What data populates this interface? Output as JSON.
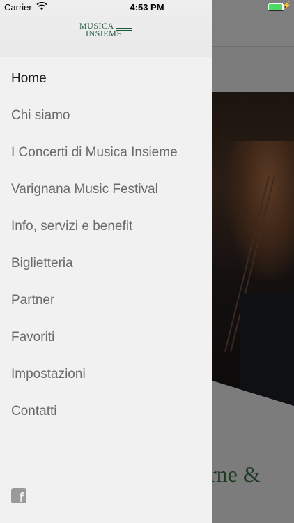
{
  "status_bar": {
    "carrier": "Carrier",
    "time": "4:53 PM"
  },
  "logo": {
    "line1": "MUSICA",
    "line2": "INSIEME"
  },
  "menu": {
    "items": [
      {
        "label": "Home"
      },
      {
        "label": "Chi siamo"
      },
      {
        "label": "I Concerti di Musica Insieme"
      },
      {
        "label": "Varignana Music Festival"
      },
      {
        "label": "Info, servizi e benefit"
      },
      {
        "label": "Biglietteria"
      },
      {
        "label": "Partner"
      },
      {
        "label": "Favoriti"
      },
      {
        "label": "Impostazioni"
      },
      {
        "label": "Contatti"
      }
    ],
    "active_index": 0
  },
  "background": {
    "title_fragment": "rne &"
  },
  "footer": {
    "social_icon": "facebook-icon"
  },
  "colors": {
    "brand_green": "#1e5a3a",
    "drawer_bg": "#f1f1f1",
    "overlay": "#7c7c7c",
    "battery": "#4cd964"
  }
}
